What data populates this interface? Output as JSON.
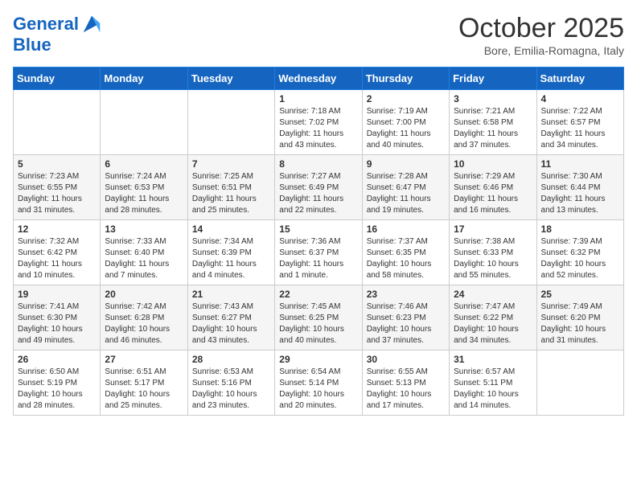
{
  "logo": {
    "line1": "General",
    "line2": "Blue"
  },
  "title": "October 2025",
  "location": "Bore, Emilia-Romagna, Italy",
  "days_of_week": [
    "Sunday",
    "Monday",
    "Tuesday",
    "Wednesday",
    "Thursday",
    "Friday",
    "Saturday"
  ],
  "weeks": [
    [
      {
        "day": "",
        "content": ""
      },
      {
        "day": "",
        "content": ""
      },
      {
        "day": "",
        "content": ""
      },
      {
        "day": "1",
        "content": "Sunrise: 7:18 AM\nSunset: 7:02 PM\nDaylight: 11 hours and 43 minutes."
      },
      {
        "day": "2",
        "content": "Sunrise: 7:19 AM\nSunset: 7:00 PM\nDaylight: 11 hours and 40 minutes."
      },
      {
        "day": "3",
        "content": "Sunrise: 7:21 AM\nSunset: 6:58 PM\nDaylight: 11 hours and 37 minutes."
      },
      {
        "day": "4",
        "content": "Sunrise: 7:22 AM\nSunset: 6:57 PM\nDaylight: 11 hours and 34 minutes."
      }
    ],
    [
      {
        "day": "5",
        "content": "Sunrise: 7:23 AM\nSunset: 6:55 PM\nDaylight: 11 hours and 31 minutes."
      },
      {
        "day": "6",
        "content": "Sunrise: 7:24 AM\nSunset: 6:53 PM\nDaylight: 11 hours and 28 minutes."
      },
      {
        "day": "7",
        "content": "Sunrise: 7:25 AM\nSunset: 6:51 PM\nDaylight: 11 hours and 25 minutes."
      },
      {
        "day": "8",
        "content": "Sunrise: 7:27 AM\nSunset: 6:49 PM\nDaylight: 11 hours and 22 minutes."
      },
      {
        "day": "9",
        "content": "Sunrise: 7:28 AM\nSunset: 6:47 PM\nDaylight: 11 hours and 19 minutes."
      },
      {
        "day": "10",
        "content": "Sunrise: 7:29 AM\nSunset: 6:46 PM\nDaylight: 11 hours and 16 minutes."
      },
      {
        "day": "11",
        "content": "Sunrise: 7:30 AM\nSunset: 6:44 PM\nDaylight: 11 hours and 13 minutes."
      }
    ],
    [
      {
        "day": "12",
        "content": "Sunrise: 7:32 AM\nSunset: 6:42 PM\nDaylight: 11 hours and 10 minutes."
      },
      {
        "day": "13",
        "content": "Sunrise: 7:33 AM\nSunset: 6:40 PM\nDaylight: 11 hours and 7 minutes."
      },
      {
        "day": "14",
        "content": "Sunrise: 7:34 AM\nSunset: 6:39 PM\nDaylight: 11 hours and 4 minutes."
      },
      {
        "day": "15",
        "content": "Sunrise: 7:36 AM\nSunset: 6:37 PM\nDaylight: 11 hours and 1 minute."
      },
      {
        "day": "16",
        "content": "Sunrise: 7:37 AM\nSunset: 6:35 PM\nDaylight: 10 hours and 58 minutes."
      },
      {
        "day": "17",
        "content": "Sunrise: 7:38 AM\nSunset: 6:33 PM\nDaylight: 10 hours and 55 minutes."
      },
      {
        "day": "18",
        "content": "Sunrise: 7:39 AM\nSunset: 6:32 PM\nDaylight: 10 hours and 52 minutes."
      }
    ],
    [
      {
        "day": "19",
        "content": "Sunrise: 7:41 AM\nSunset: 6:30 PM\nDaylight: 10 hours and 49 minutes."
      },
      {
        "day": "20",
        "content": "Sunrise: 7:42 AM\nSunset: 6:28 PM\nDaylight: 10 hours and 46 minutes."
      },
      {
        "day": "21",
        "content": "Sunrise: 7:43 AM\nSunset: 6:27 PM\nDaylight: 10 hours and 43 minutes."
      },
      {
        "day": "22",
        "content": "Sunrise: 7:45 AM\nSunset: 6:25 PM\nDaylight: 10 hours and 40 minutes."
      },
      {
        "day": "23",
        "content": "Sunrise: 7:46 AM\nSunset: 6:23 PM\nDaylight: 10 hours and 37 minutes."
      },
      {
        "day": "24",
        "content": "Sunrise: 7:47 AM\nSunset: 6:22 PM\nDaylight: 10 hours and 34 minutes."
      },
      {
        "day": "25",
        "content": "Sunrise: 7:49 AM\nSunset: 6:20 PM\nDaylight: 10 hours and 31 minutes."
      }
    ],
    [
      {
        "day": "26",
        "content": "Sunrise: 6:50 AM\nSunset: 5:19 PM\nDaylight: 10 hours and 28 minutes."
      },
      {
        "day": "27",
        "content": "Sunrise: 6:51 AM\nSunset: 5:17 PM\nDaylight: 10 hours and 25 minutes."
      },
      {
        "day": "28",
        "content": "Sunrise: 6:53 AM\nSunset: 5:16 PM\nDaylight: 10 hours and 23 minutes."
      },
      {
        "day": "29",
        "content": "Sunrise: 6:54 AM\nSunset: 5:14 PM\nDaylight: 10 hours and 20 minutes."
      },
      {
        "day": "30",
        "content": "Sunrise: 6:55 AM\nSunset: 5:13 PM\nDaylight: 10 hours and 17 minutes."
      },
      {
        "day": "31",
        "content": "Sunrise: 6:57 AM\nSunset: 5:11 PM\nDaylight: 10 hours and 14 minutes."
      },
      {
        "day": "",
        "content": ""
      }
    ]
  ]
}
